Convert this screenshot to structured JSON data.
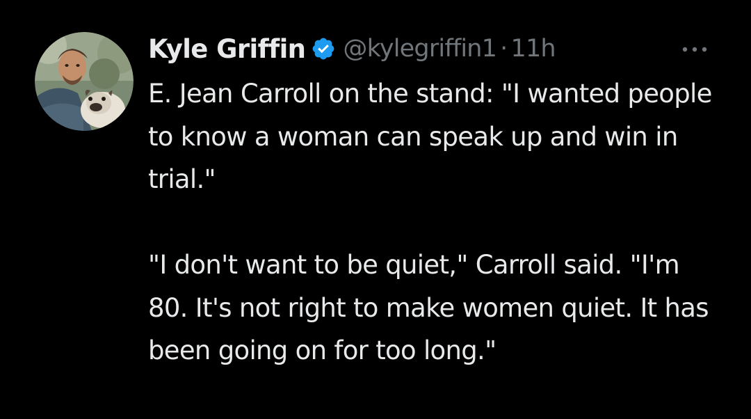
{
  "tweet": {
    "author": {
      "display_name": "Kyle Griffin",
      "handle": "@kylegriffin1",
      "verified_icon": "verified-badge-icon",
      "avatar_icon": "profile-photo"
    },
    "separator": "·",
    "timestamp": "11h",
    "more_icon": "more-options-icon",
    "text": {
      "paragraph_1": "E. Jean Carroll on the stand: \"I wanted people to know a woman can speak up and win in trial.\"",
      "paragraph_2": "\"I don't want to be quiet,\" Carroll said. \"I'm 80. It's not right to make women quiet. It has been going on for too long.\""
    }
  },
  "colors": {
    "background": "#000000",
    "primary_text": "#e7e9ea",
    "secondary_text": "#71767b",
    "verified_blue": "#1d9bf0"
  }
}
